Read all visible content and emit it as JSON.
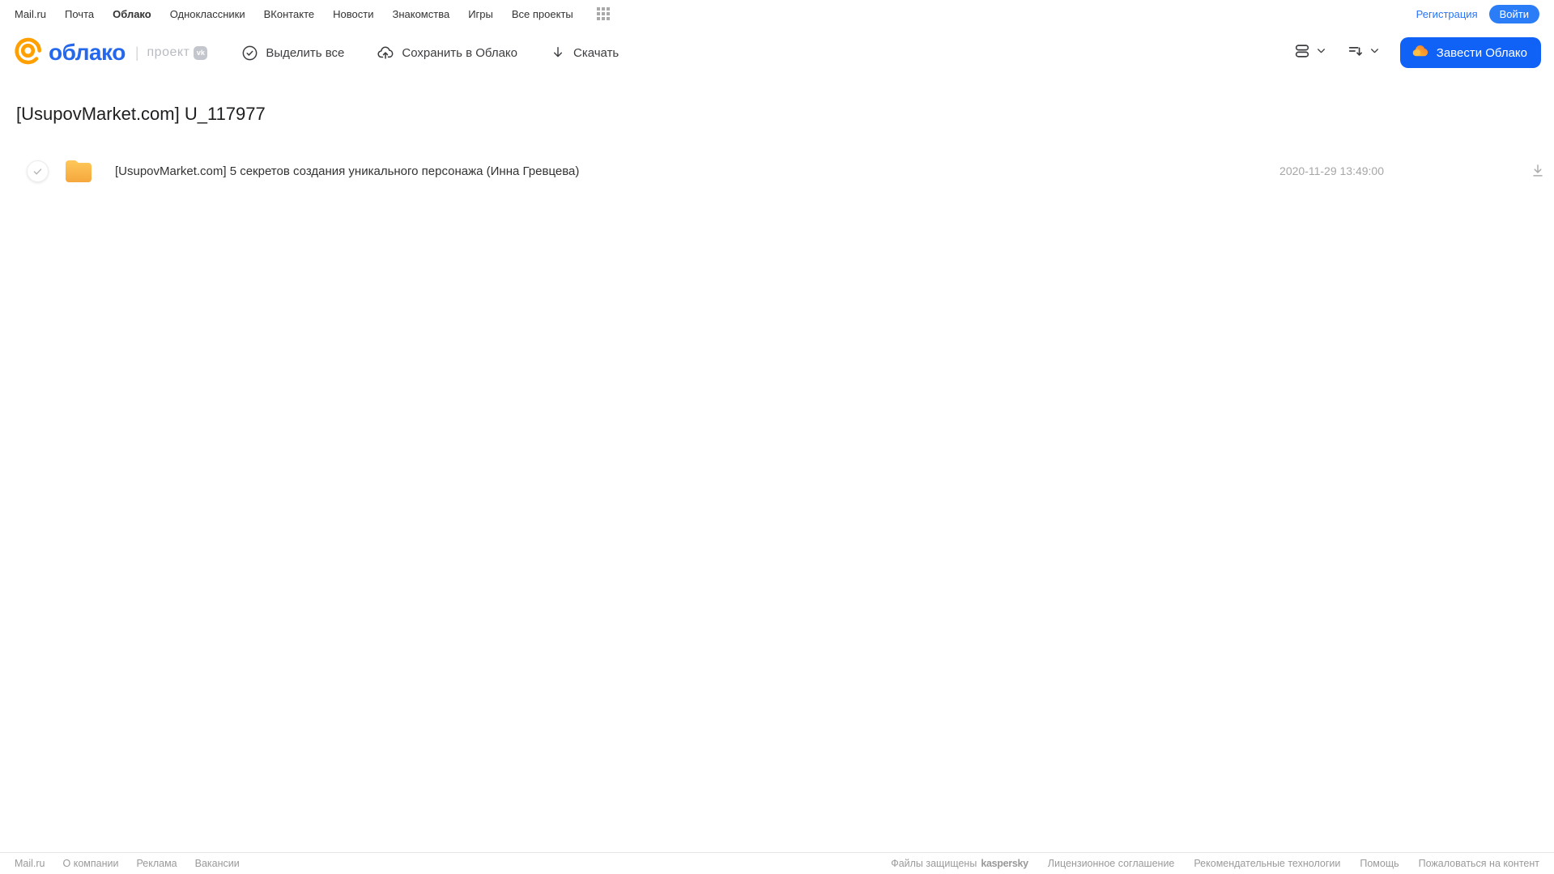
{
  "topnav": {
    "items": [
      "Mail.ru",
      "Почта",
      "Облако",
      "Одноклассники",
      "ВКонтакте",
      "Новости",
      "Знакомства",
      "Игры",
      "Все проекты"
    ],
    "active_item": "Облако",
    "registration_label": "Регистрация",
    "login_label": "Войти"
  },
  "header": {
    "logo_text": "облако",
    "project_label": "проект",
    "vk_badge_label": "vk",
    "toolbar": {
      "select_all_label": "Выделить все",
      "save_to_cloud_label": "Сохранить в Облако",
      "download_label": "Скачать"
    },
    "get_cloud_label": "Завести Облако"
  },
  "main": {
    "title": "[UsupovMarket.com] U_117977",
    "files": [
      {
        "type": "folder",
        "name": "[UsupovMarket.com] 5 секретов создания уникального персонажа (Инна Гревцева)",
        "date": "2020-11-29 13:49:00"
      }
    ]
  },
  "footer": {
    "left_links": [
      "Mail.ru",
      "О компании",
      "Реклама",
      "Вакансии"
    ],
    "protected_label": "Файлы защищены",
    "kaspersky_label": "kaspersky",
    "right_links": [
      "Лицензионное соглашение",
      "Рекомендательные технологии",
      "Помощь",
      "Пожаловаться на контент"
    ]
  },
  "icons": {
    "logo": "at-sign",
    "select_all": "check-circle",
    "save_to_cloud": "cloud-upload",
    "download": "arrow-down",
    "view_toggle": "stacked-rows",
    "sort": "sort-lines-arrow",
    "get_cloud": "orange-cloud",
    "apps": "grid-3x3",
    "row_check": "checkmark",
    "folder": "yellow-folder",
    "row_download": "download-underline"
  },
  "colors": {
    "link_blue": "#2775fc",
    "logo_blue": "#2668eb",
    "button_blue": "#0f62f5",
    "logo_orange": "#ffa000",
    "folder_yellow_top": "#ffc859",
    "folder_yellow_bottom": "#f5a73e",
    "kaspersky_teal": "#00a88e",
    "footer_gray": "#9a9a9a"
  }
}
